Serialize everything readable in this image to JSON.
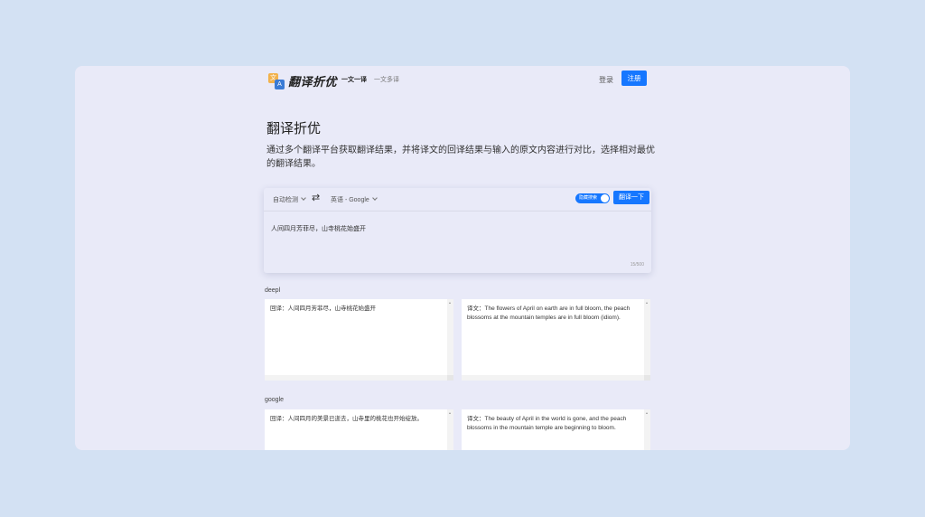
{
  "header": {
    "logo_text": "翻译折优",
    "logo_badge_a": "文",
    "logo_badge_b": "A",
    "nav": [
      "一文一译",
      "一文多译"
    ],
    "login": "登录",
    "register": "注册"
  },
  "hero": {
    "title": "翻译折优",
    "description": "通过多个翻译平台获取翻译结果，并将译文的回译结果与输入的原文内容进行对比，选择相对最优的翻译结果。"
  },
  "translator": {
    "source_lang": "自动检测",
    "target_lang": "英语 - Google",
    "toggle_label": "隐藏搜索",
    "translate_button": "翻译一下",
    "input_text": "人间四月芳菲尽，山寺桃花始盛开",
    "char_count": "15/500"
  },
  "results": [
    {
      "provider": "deepl",
      "back_translation": "回译：人间四月芳菲尽，山寺桃花始盛开",
      "translation": "译文：The flowers of April on earth are in full bloom, the peach blossoms at the mountain temples are in full bloom (idiom)."
    },
    {
      "provider": "google",
      "back_translation": "回译：人间四月的美景已逝去，山寺里的桃花也开始绽放。",
      "translation": "译文：The beauty of April in the world is gone, and the peach blossoms in the mountain temple are beginning to bloom."
    }
  ]
}
